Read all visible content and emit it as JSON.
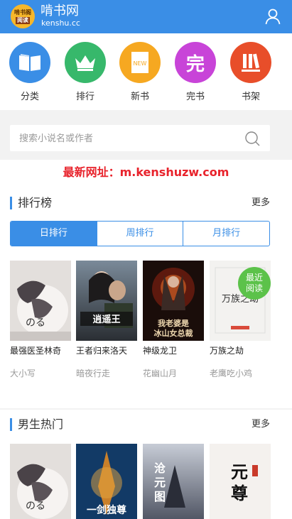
{
  "header": {
    "logo_line1": "啃书阁",
    "logo_line2": "阅读",
    "site_name": "啃书网",
    "site_domain": "kenshu.cc",
    "colors": {
      "primary": "#3a8ee6"
    },
    "user_icon": "user-icon"
  },
  "nav": {
    "items": [
      {
        "label": "分类",
        "icon": "book-open-icon",
        "color": "#3a8ee6"
      },
      {
        "label": "排行",
        "icon": "crown-icon",
        "color": "#37b86b"
      },
      {
        "label": "新书",
        "icon": "new-book-icon",
        "color": "#f6a821",
        "badge": "NEW"
      },
      {
        "label": "完书",
        "icon": "finished-icon",
        "color": "#c844d8",
        "glyph": "完"
      },
      {
        "label": "书架",
        "icon": "bookshelf-icon",
        "color": "#e84e2a"
      }
    ]
  },
  "search": {
    "placeholder": "搜索小说名或作者",
    "icon": "search-icon"
  },
  "notice": "最新网址：m.kenshuzw.com",
  "ranking": {
    "title": "排行榜",
    "more": "更多",
    "tabs": [
      "日排行",
      "周排行",
      "月排行"
    ],
    "active_tab": 0,
    "books": [
      {
        "title": "最强医圣林奇",
        "author": "大小写"
      },
      {
        "title": "王者归来洛天",
        "author": "暗夜行走"
      },
      {
        "title": "神级龙卫",
        "author": "花幽山月"
      },
      {
        "title": "万族之劫",
        "author": "老鹰吃小鸡"
      }
    ],
    "recent_badge": [
      "最近",
      "阅读"
    ]
  },
  "male_hot": {
    "title": "男生热门",
    "more": "更多"
  }
}
